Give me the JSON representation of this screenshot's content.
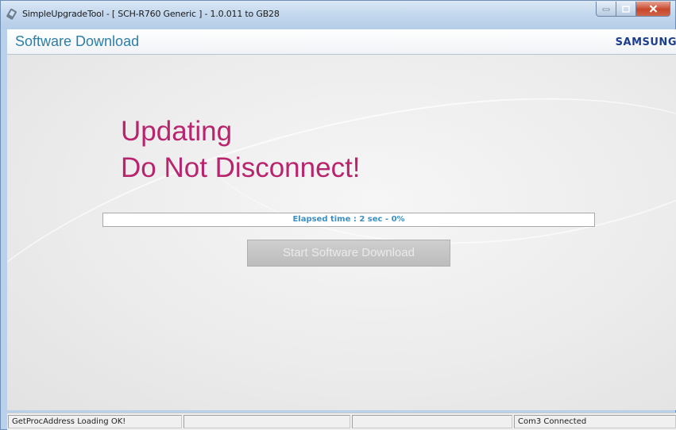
{
  "window": {
    "title": "SimpleUpgradeTool - [ SCH-R760 Generic ] - 1.0.011 to GB28",
    "icons": {
      "app": "phone-icon",
      "minimize": "minimize-icon",
      "maximize": "maximize-icon",
      "close": "close-icon"
    }
  },
  "header": {
    "title": "Software Download",
    "brand": "SAMSUNG"
  },
  "main": {
    "headline_line1": "Updating",
    "headline_line2": "Do Not Disconnect!",
    "progress_text": "Elapsed time : 2 sec - 0%",
    "progress_fraction": 0,
    "start_button_label": "Start Software Download"
  },
  "statusbar": {
    "panels": [
      "GetProcAddress Loading OK!",
      "",
      "",
      "Com3 Connected"
    ]
  },
  "colors": {
    "headline": "#b8246e",
    "header_title": "#2e7fa6",
    "brand": "#1c3e8c",
    "progress_text": "#3b8fc2"
  }
}
